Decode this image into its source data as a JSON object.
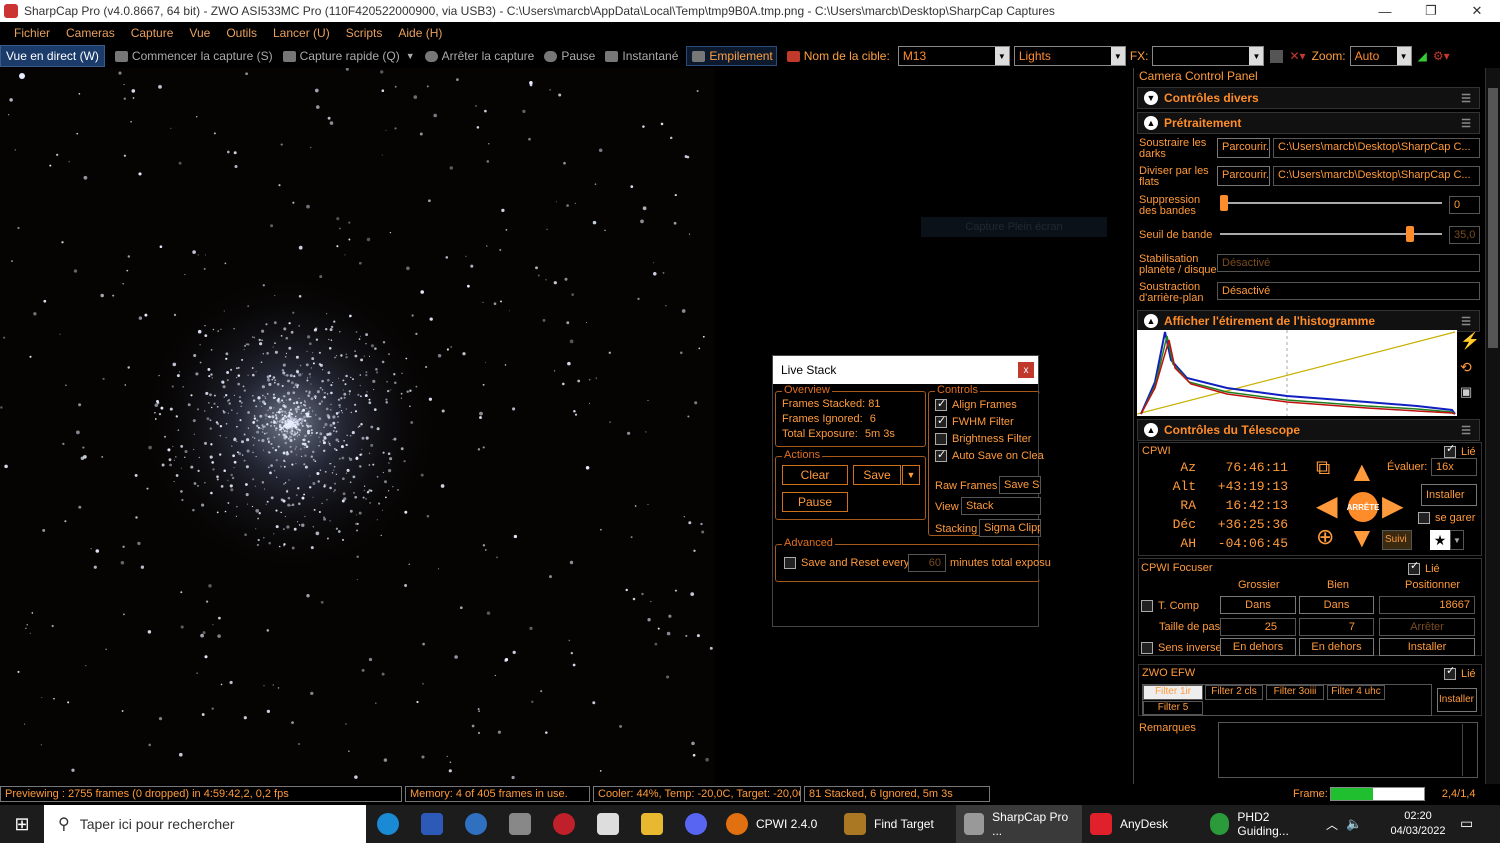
{
  "titlebar": {
    "title": "SharpCap Pro (v4.0.8667, 64 bit) - ZWO ASI533MC Pro (110F420522000900, via USB3) - C:\\Users\\marcb\\AppData\\Local\\Temp\\tmp9B0A.tmp.png - C:\\Users\\marcb\\Desktop\\SharpCap Captures",
    "min": "—",
    "restore": "❐",
    "close": "✕"
  },
  "menu": [
    "Fichier",
    "Cameras",
    "Capture",
    "Vue",
    "Outils",
    "Lancer (U)",
    "Scripts",
    "Aide (H)"
  ],
  "toolbar": {
    "live": "Vue en direct (W)",
    "start": "Commencer la capture (S)",
    "quick": "Capture rapide (Q)",
    "stop": "Arrêter la capture",
    "pause": "Pause",
    "snapshot": "Instantané",
    "stack": "Empilement",
    "target_label": "Nom de la cible:",
    "target_value": "M13",
    "frame_type": "Lights",
    "fx_label": "FX:",
    "fx_value": "",
    "zoom_label": "Zoom:",
    "zoom_value": "Auto"
  },
  "ghost_button": "Capture Plein écran",
  "live_stack": {
    "title": "Live Stack",
    "close": "x",
    "overview": {
      "legend": "Overview",
      "rows": [
        {
          "label": "Frames Stacked:",
          "value": "81"
        },
        {
          "label": "Frames Ignored:",
          "value": "6"
        },
        {
          "label": "Total Exposure:",
          "value": "5m 3s"
        }
      ]
    },
    "actions": {
      "legend": "Actions",
      "clear": "Clear",
      "save": "Save",
      "pause": "Pause"
    },
    "controls": {
      "legend": "Controls",
      "checks": [
        {
          "label": "Align Frames",
          "checked": true
        },
        {
          "label": "FWHM Filter",
          "checked": true
        },
        {
          "label": "Brightness Filter",
          "checked": false
        },
        {
          "label": "Auto Save on Clea",
          "checked": true
        }
      ],
      "raw_label": "Raw Frames",
      "raw_value": "Save St",
      "view_label": "View",
      "view_value": "Stack",
      "stacking_label": "Stacking",
      "stacking_value": "Sigma Clipp"
    },
    "advanced": {
      "legend": "Advanced",
      "label": "Save and Reset every",
      "value": "60",
      "suffix": "minutes total exposu"
    }
  },
  "panel": {
    "title": "Camera Control Panel",
    "pin": "⊥",
    "misc": {
      "title": "Contrôles divers"
    },
    "pre": {
      "title": "Prétraitement",
      "darks_label1": "Soustraire les",
      "darks_label2": "darks",
      "darks_btn": "Parcourir...",
      "darks_path": "C:\\Users\\marcb\\Desktop\\SharpCap C...",
      "flats_label1": "Diviser par les",
      "flats_label2": "flats",
      "flats_btn": "Parcourir...",
      "flats_path": "C:\\Users\\marcb\\Desktop\\SharpCap C...",
      "band_label1": "Suppression",
      "band_label2": "des bandes",
      "band_value": "0",
      "band_level": 0,
      "thresh_label": "Seuil de bande",
      "thresh_value": "35,0",
      "thresh_level": 0.87,
      "stab_label1": "Stabilisation",
      "stab_label2": "planète / disque",
      "stab_value": "Désactivé",
      "bg_label1": "Soustraction",
      "bg_label2": "d'arrière-plan",
      "bg_value": "Désactivé"
    },
    "histo": {
      "title": "Afficher l'étirement de l'histogramme"
    },
    "telescope": {
      "title": "Contrôles du Télescope",
      "name": "CPWI",
      "linked": "Lié",
      "coords": [
        {
          "label": "Az",
          "value": "76:46:11"
        },
        {
          "label": "Alt",
          "value": "+43:19:13"
        },
        {
          "label": "RA",
          "value": "16:42:13"
        },
        {
          "label": "Déc",
          "value": "+36:25:36"
        },
        {
          "label": "AH",
          "value": "-04:06:45"
        }
      ],
      "stop": "ARRÊTE",
      "track": "Suivi",
      "rate_label": "Évaluer:",
      "rate_value": "16x",
      "setup": "Installer",
      "park": "se garer"
    },
    "focuser": {
      "title": "CPWI Focuser",
      "linked": "Lié",
      "coarse": "Grossier",
      "fine": "Bien",
      "position_label": "Positionner",
      "in1": "Dans",
      "in2": "Dans",
      "position": "18667",
      "tcomp": "T. Comp",
      "step_label": "Taille de pas",
      "step1": "25",
      "step2": "7",
      "stop": "Arrêter",
      "reverse": "Sens inverse",
      "out1": "En dehors",
      "out2": "En dehors",
      "setup": "Installer"
    },
    "efw": {
      "title": "ZWO EFW",
      "linked": "Lié",
      "filters": [
        "Filter 1ir",
        "Filter 2 cls",
        "Filter 3oiii",
        "Filter 4 uhc",
        "Filter 5"
      ],
      "setup": "Installer"
    },
    "notes": {
      "label": "Remarques"
    }
  },
  "status": {
    "preview": "Previewing : 2755 frames (0 dropped) in 4:59:42,2, 0,2 fps",
    "memory": "Memory: 4 of 405 frames in use.",
    "cooler": "Cooler: 44%, Temp: -20,0C, Target: -20,0C",
    "stacked": "81 Stacked, 6 Ignored, 5m 3s",
    "frame_label": "Frame:",
    "frame_value": "2,4/1,4",
    "frame_fill": 0.45
  },
  "taskbar": {
    "search": "Taper ici pour rechercher",
    "apps": [
      "CPWI 2.4.0",
      "Find Target",
      "SharpCap Pro ...",
      "AnyDesk",
      "PHD2 Guiding..."
    ],
    "time": "02:20",
    "date": "04/03/2022"
  },
  "colors": {
    "accent": "#ff9a3c",
    "panel_bg": "#000000",
    "title_orange": "#ff8c2a"
  }
}
